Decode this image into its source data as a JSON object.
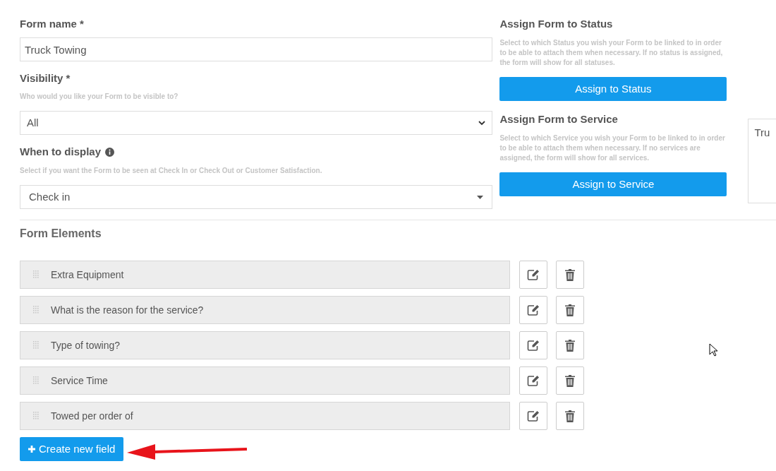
{
  "form_name": {
    "label": "Form name *",
    "value": "Truck Towing"
  },
  "visibility": {
    "label": "Visibility *",
    "help": "Who would you like your Form to be visible to?",
    "value": "All"
  },
  "when_to_display": {
    "label": "When to display",
    "help": "Select if you want the Form to be seen at Check In or Check Out or Customer Satisfaction.",
    "value": "Check in"
  },
  "assign_status": {
    "title": "Assign Form to Status",
    "help": "Select to which Status you wish your Form to be linked to in order to be able to attach them when necessary. If no status is assigned, the form will show for all statuses.",
    "button": "Assign to Status"
  },
  "assign_service": {
    "title": "Assign Form to Service",
    "help": "Select to which Service you wish your Form to be linked to in order to be able to attach them when necessary. If no services are assigned, the form will show for all services.",
    "button": "Assign to Service"
  },
  "side_panel": {
    "text": "Tru"
  },
  "form_elements": {
    "title": "Form Elements",
    "items": [
      {
        "label": "Extra Equipment"
      },
      {
        "label": "What is the reason for the service?"
      },
      {
        "label": "Type of towing?"
      },
      {
        "label": "Service Time"
      },
      {
        "label": "Towed per order of"
      }
    ],
    "create_button": "Create new field"
  }
}
